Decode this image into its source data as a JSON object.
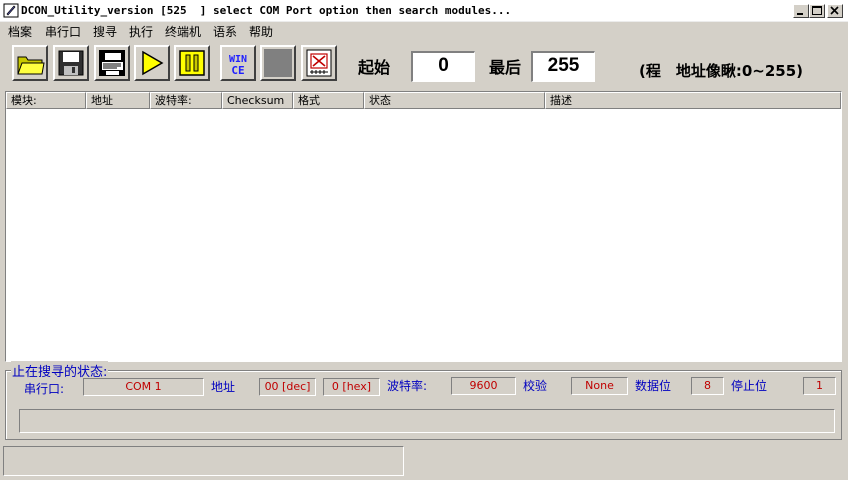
{
  "window": {
    "title": "DCON_Utility_version [525  ] select COM Port option then search modules..."
  },
  "menu": [
    "档案",
    "串行口",
    "搜寻",
    "执行",
    "终端机",
    "语系",
    "帮助"
  ],
  "toolbar": {
    "buttons": [
      "open-folder-icon",
      "save-disk-icon",
      "terminal-icon",
      "play-icon",
      "pause-icon",
      "wince-icon",
      "stop-square-icon",
      "module-icon"
    ],
    "wince_label_top": "WIN",
    "wince_label_bottom": "CE",
    "start_label": "起始",
    "start_value": "0",
    "end_label": "最后",
    "end_value": "255",
    "range_hint": "(程　地址像瞅:0~255)"
  },
  "list": {
    "columns": [
      "模块:",
      "地址",
      "波特率:",
      "Checksum",
      "格式",
      "状态",
      "描述"
    ],
    "rows": []
  },
  "status_group": {
    "title": "止在搜寻的状态:",
    "com_label": "串行口:",
    "com_value": "COM 1",
    "addr_label": "地址",
    "addr_dec": "00 [dec]",
    "addr_hex": "0 [hex]",
    "baud_label": "波特率:",
    "baud_value": "9600",
    "check_label": "校验",
    "check_value": "None",
    "data_label": "数据位",
    "data_value": "8",
    "stop_label": "停止位",
    "stop_value": "1"
  },
  "colors": {
    "face": "#d4d0c8",
    "label_blue": "#0000c0",
    "value_red": "#c00000"
  }
}
